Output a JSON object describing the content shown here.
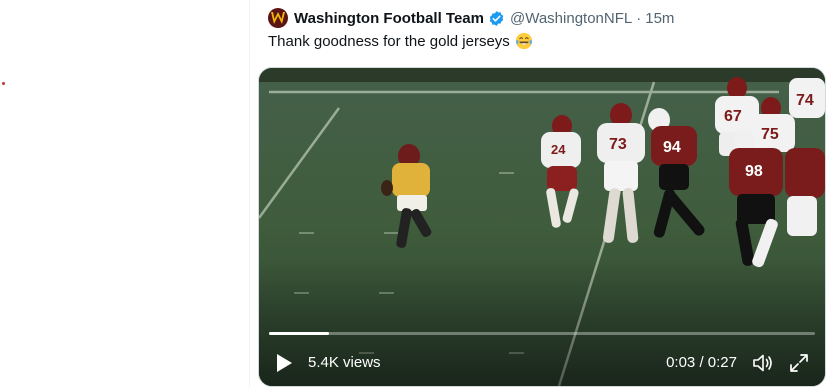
{
  "tweet": {
    "author_name": "Washington Football Team",
    "handle": "@WashingtonNFL",
    "separator": "·",
    "timestamp": "15m",
    "text": "Thank goodness for the gold jerseys",
    "emoji": "face-with-tears-of-joy",
    "verified": true,
    "avatar_color": "#5a1414",
    "avatar_accent": "#f2b705"
  },
  "video": {
    "views_label": "5.4K views",
    "current_time": "0:03",
    "duration": "0:27",
    "time_separator": "/",
    "progress_fraction": 0.11,
    "jersey_numbers": [
      "67",
      "74",
      "75",
      "98",
      "24",
      "73",
      "94"
    ]
  },
  "colors": {
    "text_primary": "#0f1419",
    "text_secondary": "#536471",
    "verified_blue": "#1d9bf0",
    "field_green": "#3e5a3a"
  }
}
